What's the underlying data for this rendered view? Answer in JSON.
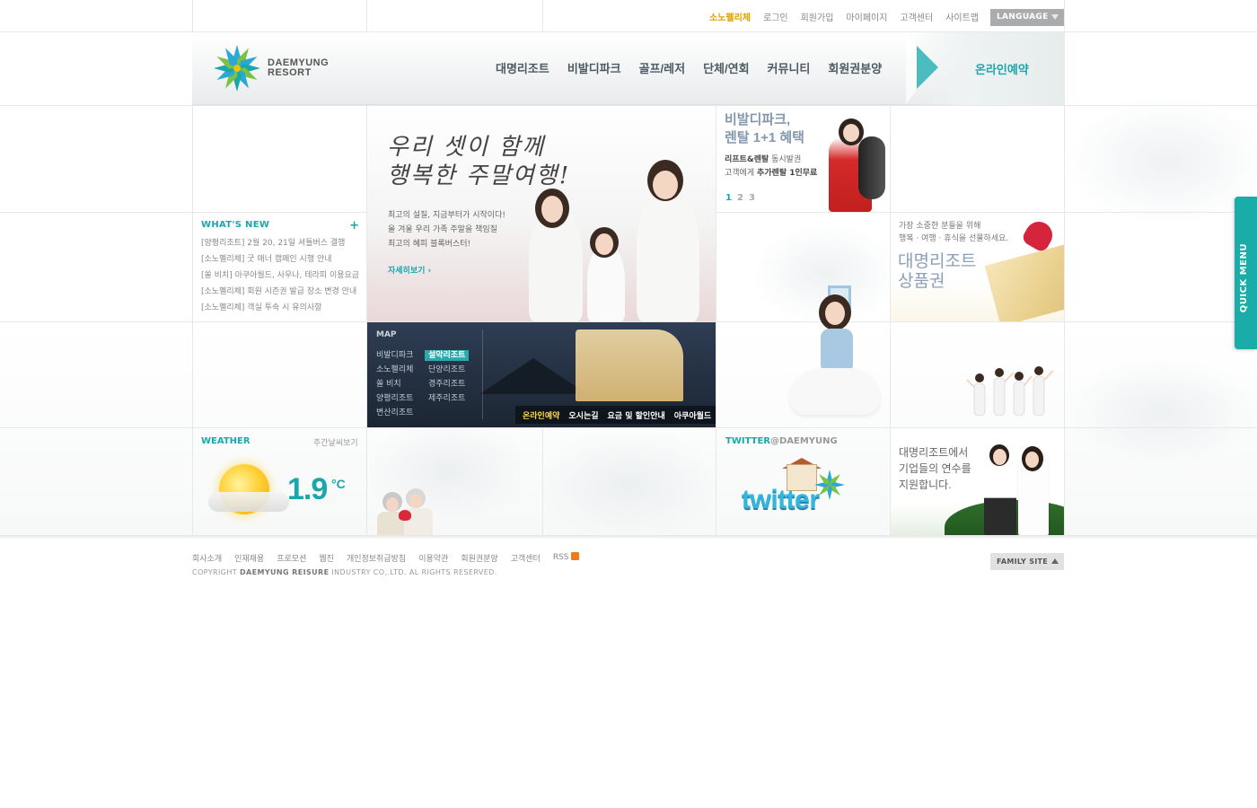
{
  "utility_nav": {
    "items": [
      "소노펠리체",
      "로그인",
      "회원가입",
      "마이페이지",
      "고객센터",
      "사이트맵"
    ],
    "language_label": "LANGUAGE"
  },
  "brand": {
    "logo_line1": "DAEMYUNG",
    "logo_line2": "RESORT"
  },
  "main_nav": {
    "items": [
      "대명리조트",
      "비발디파크",
      "골프/레저",
      "단체/연회",
      "커뮤니티",
      "회원권분양"
    ],
    "reservation_label": "온라인예약"
  },
  "hero": {
    "title_line1": "우리 셋이 함께",
    "title_line2": "행복한 주말여행!",
    "desc_line1": "최고의 설질, 지금부터가 시작이다!",
    "desc_line2": "올 겨울 우리 가족 주말을 책임질",
    "desc_line3": "최고의 혜피 블록버스터!",
    "more_label": "자세히보기"
  },
  "rental_banner": {
    "title_line1": "비발디파크,",
    "title_line2": "렌탈 1+1 혜택",
    "desc_line1_bold": "리프트&렌탈",
    "desc_line1_rest": " 동시발권",
    "desc_line2_rest": "고객에게 ",
    "desc_line2_bold": "추가렌탈 1인무료",
    "pages": [
      "1",
      "2",
      "3"
    ],
    "active_page": "1"
  },
  "whats_new": {
    "title": "WHAT'S NEW",
    "plus": "+",
    "items": [
      "[양평리조트] 2월 20, 21일 셔틀버스 결행",
      "[소노펠리체] 굿 매너 캠페인 시행 안내",
      "[쏠 비치] 아쿠아월드, 사우나, 테라피 이용요금",
      "[소노펠리체] 회원 시즌권 발급 장소 변경 안내",
      "[소노펠리체] 객실 투숙 시 유의사항"
    ]
  },
  "map": {
    "title": "MAP",
    "col1": [
      "비발디파크",
      "소노펠리체",
      "쏠 비치",
      "양평리조트",
      "변산리조트"
    ],
    "col2": [
      "설악리조트",
      "단양리조트",
      "경주리조트",
      "제주리조트"
    ],
    "selected": "설악리조트",
    "bar_items": [
      "온라인예약",
      "오시는길",
      "요금 및 할인안내",
      "아쿠아월드"
    ]
  },
  "gift": {
    "line1": "가장 소중한 분들을 위해",
    "line2": "행복 · 여행 · 휴식을 선물하세요.",
    "title_line1": "대명리조트",
    "title_line2": "상품권"
  },
  "weather": {
    "title": "WEATHER",
    "weekly_label": "주간날씨보기",
    "temperature": "1.9",
    "unit": "°C"
  },
  "twitter": {
    "title_main": "TWITTER",
    "title_handle": "@DAEMYUNG",
    "logo_text": "twitter"
  },
  "corporate": {
    "line1": "대명리조트에서",
    "line2": "기업들의 연수를",
    "line3": "지원합니다."
  },
  "quick_menu": {
    "label": "QUICK MENU"
  },
  "footer": {
    "links": [
      "회사소개",
      "인재채용",
      "프로모션",
      "웹진",
      "개인정보취급방침",
      "이용약관",
      "회원권분양",
      "고객센터",
      "RSS"
    ],
    "copyright_prefix": "COPYRIGHT ",
    "copyright_bold": "DAEMYUNG REISURE",
    "copyright_rest": " INDUSTRY CO,.LTD. AL RIGHTS RESERVED.",
    "family_site_label": "FAMILY SITE"
  },
  "colors": {
    "accent": "#1aa7ac",
    "highlight": "#e0a000",
    "quick_menu": "#19aca8"
  }
}
